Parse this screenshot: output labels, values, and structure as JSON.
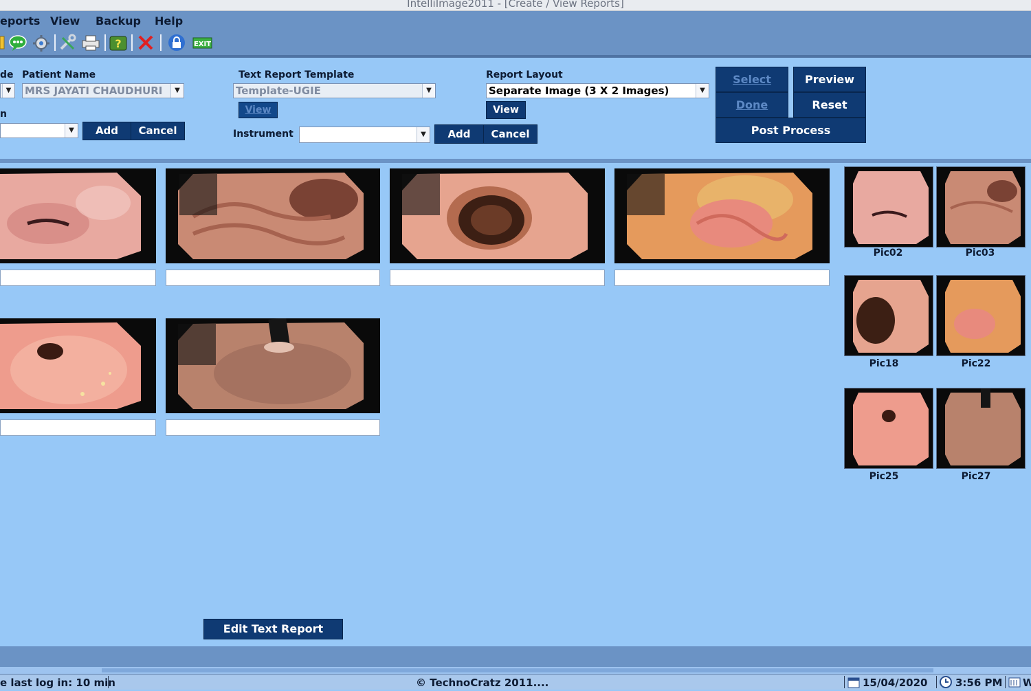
{
  "window": {
    "title": "IntelliImage2011 - [Create / View Reports]"
  },
  "menu": [
    "eports",
    "View",
    "Backup",
    "Help"
  ],
  "toolbar": {
    "icons": [
      "folder-icon",
      "chat-icon",
      "settings-gear-icon",
      "wrench-tools-icon",
      "printer-icon",
      "help-icon",
      "delete-icon",
      "lock-icon",
      "exit-icon"
    ],
    "exit_label": "EXIT"
  },
  "form": {
    "code_label": "de",
    "patient_name_label": "Patient Name",
    "patient_name_value": "MRS JAYATI CHAUDHURI",
    "left_second_label": "n",
    "left_add": "Add",
    "left_cancel": "Cancel",
    "template_label": "Text Report Template",
    "template_value": "Template-UGIE",
    "template_view": "View",
    "instrument_label": "Instrument",
    "instrument_value": "",
    "instrument_add": "Add",
    "instrument_cancel": "Cancel",
    "layout_label": "Report Layout",
    "layout_value": "Separate Image (3 X 2 Images)",
    "layout_view": "View",
    "select": "Select",
    "preview": "Preview",
    "done": "Done",
    "reset": "Reset",
    "post_process": "Post Process"
  },
  "report_images": [
    {
      "caption": ""
    },
    {
      "caption": ""
    },
    {
      "caption": ""
    },
    {
      "caption": ""
    },
    {
      "caption": ""
    },
    {
      "caption": ""
    }
  ],
  "thumbnails": [
    "Pic02",
    "Pic03",
    "Pic18",
    "Pic22",
    "Pic25",
    "Pic27"
  ],
  "edit_text_report": "Edit Text Report",
  "status": {
    "last_login": "e last log in: 10 min",
    "copyright": "© TechnoCratz 2011....",
    "date": "15/04/2020",
    "time": "3:56 PM",
    "tail": "W"
  },
  "colors": {
    "background": "#97c8f7",
    "bar": "#6b93c5",
    "button": "#0f3a73",
    "button_text": "#ffffff"
  }
}
